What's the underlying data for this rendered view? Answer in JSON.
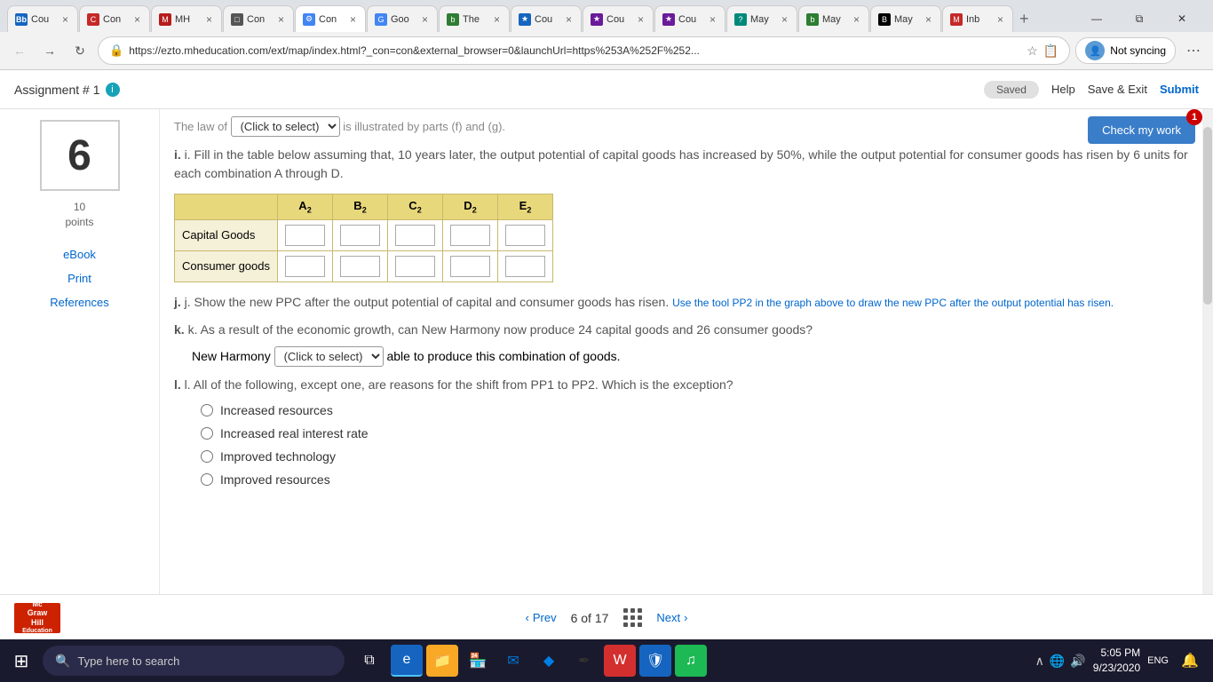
{
  "browser": {
    "tabs": [
      {
        "id": "bb",
        "title": "Cou",
        "color": "#1a73e8",
        "active": false,
        "favicon_bg": "#1565c0",
        "favicon_text": "Bb"
      },
      {
        "id": "con1",
        "title": "Con",
        "color": "#e53935",
        "active": false,
        "favicon_bg": "#c62828",
        "favicon_text": "C"
      },
      {
        "id": "mh",
        "title": "MH",
        "color": "#d32f2f",
        "active": false,
        "favicon_bg": "#b71c1c",
        "favicon_text": "M"
      },
      {
        "id": "con2",
        "title": "Con",
        "color": "#333",
        "active": false,
        "favicon_bg": "#555",
        "favicon_text": "C"
      },
      {
        "id": "con3",
        "title": "Con",
        "color": "#4285f4",
        "active": true,
        "favicon_bg": "#4285f4",
        "favicon_text": "⚙"
      },
      {
        "id": "goo",
        "title": "Goo",
        "color": "#4285f4",
        "active": false,
        "favicon_bg": "#4285f4",
        "favicon_text": "G"
      },
      {
        "id": "the",
        "title": "The",
        "color": "#2e7d32",
        "active": false,
        "favicon_bg": "#2e7d32",
        "favicon_text": "b"
      },
      {
        "id": "cou1",
        "title": "Cou",
        "color": "#1565c0",
        "active": false,
        "favicon_bg": "#1565c0",
        "favicon_text": "★"
      },
      {
        "id": "cou2",
        "title": "Cou",
        "color": "#6a1b9a",
        "active": false,
        "favicon_bg": "#6a1b9a",
        "favicon_text": "★"
      },
      {
        "id": "cou3",
        "title": "Cou",
        "color": "#6a1b9a",
        "active": false,
        "favicon_bg": "#6a1b9a",
        "favicon_text": "★"
      },
      {
        "id": "may1",
        "title": "May",
        "color": "#00897b",
        "active": false,
        "favicon_bg": "#00897b",
        "favicon_text": "?"
      },
      {
        "id": "may2",
        "title": "May",
        "color": "#2e7d32",
        "active": false,
        "favicon_bg": "#2e7d32",
        "favicon_text": "b"
      },
      {
        "id": "may3",
        "title": "May",
        "color": "#000",
        "active": false,
        "favicon_bg": "#000",
        "favicon_text": "B"
      },
      {
        "id": "inb",
        "title": "Inb",
        "color": "#c62828",
        "active": false,
        "favicon_bg": "#c62828",
        "favicon_text": "M"
      }
    ],
    "address": "https://ezto.mheducation.com/ext/map/index.html?_con=con&external_browser=0&launchUrl=https%253A%252F%252...",
    "not_syncing": "Not syncing"
  },
  "app": {
    "assignment_title": "Assignment # 1",
    "saved_label": "Saved",
    "help_label": "Help",
    "save_exit_label": "Save & Exit",
    "submit_label": "Submit",
    "check_work_label": "Check my work",
    "check_badge": "1"
  },
  "sidebar": {
    "question_number": "6",
    "points_value": "10",
    "points_label": "points",
    "ebook_label": "eBook",
    "print_label": "Print",
    "references_label": "References"
  },
  "question": {
    "law_text": "The law of",
    "click_select_label": "(Click to select)",
    "illustrated_text": "is illustrated by parts (f) and (g).",
    "part_i_text": "i. Fill in the table below assuming that, 10 years later, the output potential of capital goods has increased by 50%, while the output potential for consumer goods has risen by 6 units for each combination A through D.",
    "table": {
      "headers": [
        "",
        "A₂",
        "B₂",
        "C₂",
        "D₂",
        "E₂"
      ],
      "rows": [
        {
          "label": "Capital Goods",
          "values": [
            "",
            "",
            "",
            "",
            ""
          ]
        },
        {
          "label": "Consumer goods",
          "values": [
            "",
            "",
            "",
            "",
            ""
          ]
        }
      ]
    },
    "part_j_text": "j. Show the new PPC after the output potential of capital and consumer goods has risen.",
    "part_j_blue": "Use the tool PP2 in the graph above to draw the new PPC after the output potential has risen.",
    "part_k_text": "k. As a result of the economic growth, can New Harmony now produce 24 capital goods and 26 consumer goods?",
    "part_k_prefix": "New Harmony",
    "part_k_dropdown": "(Click to select)",
    "part_k_suffix": "able to produce this combination of goods.",
    "part_l_text": "l. All of the following, except one, are reasons for the shift from PP1 to PP2.  Which is the exception?",
    "radio_options": [
      "Increased resources",
      "Increased real interest rate",
      "Improved technology",
      "Improved resources"
    ]
  },
  "footer": {
    "prev_label": "Prev",
    "next_label": "Next",
    "page_current": "6",
    "page_total": "17",
    "of_label": "of"
  },
  "taskbar": {
    "search_placeholder": "Type here to search",
    "clock_time": "5:05 PM",
    "clock_date": "9/23/2020",
    "lang": "ENG"
  }
}
